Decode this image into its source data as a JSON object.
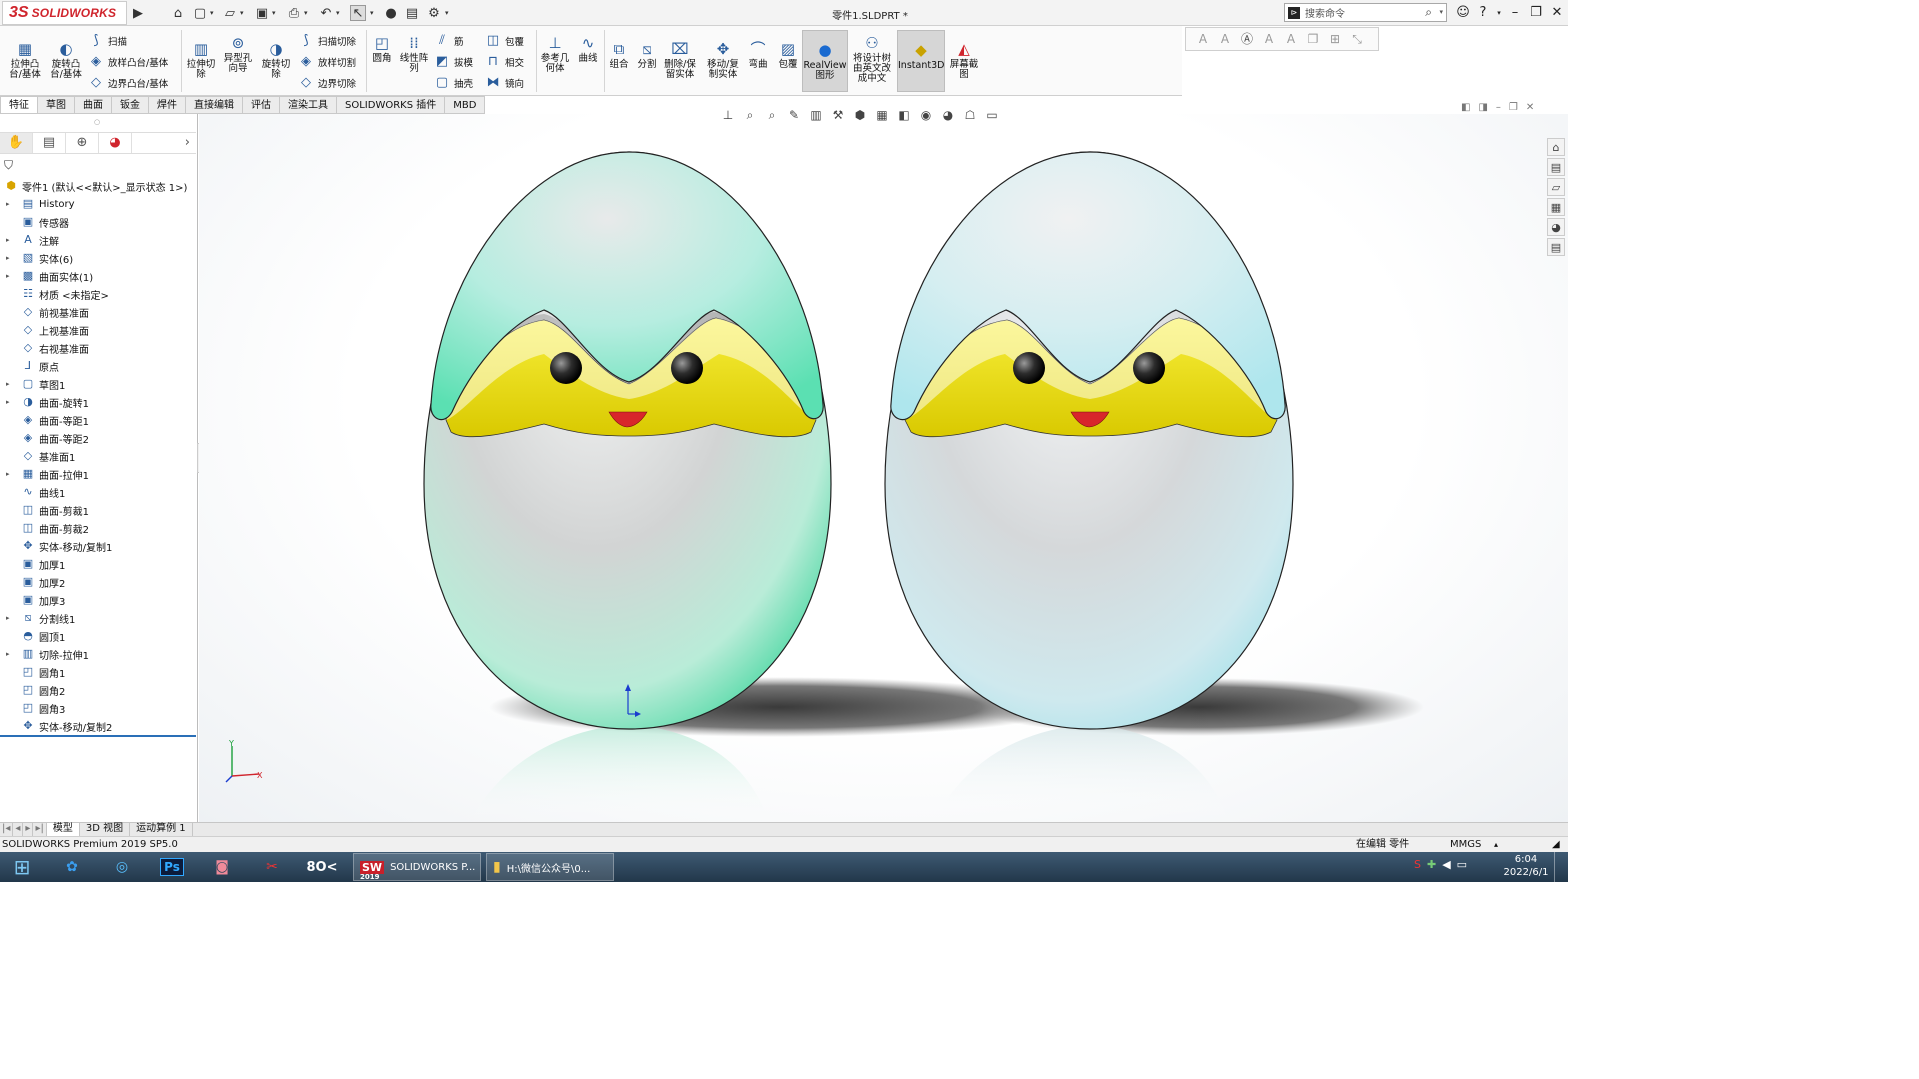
{
  "app": {
    "brand": "SOLIDWORKS",
    "brand_prefix": "3S",
    "document_title": "零件1.SLDPRT *"
  },
  "search": {
    "placeholder": "搜索命令"
  },
  "ribbon": {
    "extrude_boss": "拉伸凸台/基体",
    "revolve_boss": "旋转凸台/基体",
    "sweep": "扫描",
    "loft_boss": "放样凸台/基体",
    "boundary_boss": "边界凸台/基体",
    "extrude_cut": "拉伸切除",
    "hole_wizard": "异型孔向导",
    "revolve_cut": "旋转切除",
    "swept_cut": "扫描切除",
    "lofted_cut": "放样切割",
    "boundary_cut": "边界切除",
    "fillet": "圆角",
    "linear_pattern": "线性阵列",
    "rib": "筋",
    "draft": "拔模",
    "shell": "抽壳",
    "wrap": "包覆",
    "intersect": "相交",
    "mirror": "镜向",
    "reference_geometry": "参考几何体",
    "curves": "曲线",
    "combine": "组合",
    "split": "分割",
    "delete_keep_body": "删除/保留实体",
    "move_copy_body": "移动/复制实体",
    "flex": "弯曲",
    "wrap2": "包覆",
    "realview": "RealView图形",
    "translate_tree": "将设计树由英文改成中文",
    "instant3d": "Instant3D",
    "screen_capture": "屏幕截图"
  },
  "tabs": [
    "特征",
    "草图",
    "曲面",
    "钣金",
    "焊件",
    "直接编辑",
    "评估",
    "渲染工具",
    "SOLIDWORKS 插件",
    "MBD"
  ],
  "tree": {
    "root": "零件1 (默认<<默认>_显示状态 1>)",
    "items": [
      "History",
      "传感器",
      "注解",
      "实体(6)",
      "曲面实体(1)",
      "材质 <未指定>",
      "前视基准面",
      "上视基准面",
      "右视基准面",
      "原点",
      "草图1",
      "曲面-旋转1",
      "曲面-等距1",
      "曲面-等距2",
      "基准面1",
      "曲面-拉伸1",
      "曲线1",
      "曲面-剪裁1",
      "曲面-剪裁2",
      "实体-移动/复制1",
      "加厚1",
      "加厚2",
      "加厚3",
      "分割线1",
      "圆顶1",
      "切除-拉伸1",
      "圆角1",
      "圆角2",
      "圆角3",
      "实体-移动/复制2"
    ]
  },
  "bottom_tabs": [
    "模型",
    "3D 视图",
    "运动算例 1"
  ],
  "status": {
    "product": "SOLIDWORKS Premium 2019 SP5.0",
    "mode": "在编辑 零件",
    "units": "MMGS"
  },
  "taskbar": {
    "sw_task": "SOLIDWORKS P...",
    "folder_task": "H:\\微信公众号\\0...",
    "sw_year": "2019",
    "time": "6:04",
    "date": "2022/6/1"
  },
  "colors": {
    "egg_left": "#7de8c4",
    "egg_right": "#c5eef2",
    "chick": "#f2e21c",
    "beak": "#d8262b",
    "brand_red": "#d0252d"
  }
}
